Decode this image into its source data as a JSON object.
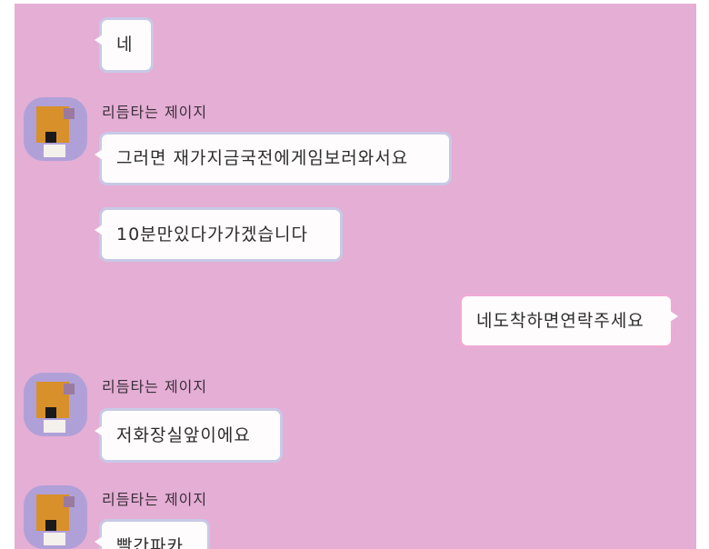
{
  "colors": {
    "chat_background": "#e4aed5",
    "bubble_background": "#fefcfd",
    "avatar_background": "#b0a0d8"
  },
  "messages": [
    {
      "type": "incoming",
      "text": "네"
    },
    {
      "type": "incoming",
      "sender": "리듬타는 제이지",
      "text": "그러면 재가지금국전에게임보러와서요"
    },
    {
      "type": "incoming",
      "text": "10분만있다가가겠습니다"
    },
    {
      "type": "outgoing",
      "text": "네도착하면연락주세요"
    },
    {
      "type": "incoming",
      "sender": "리듬타는 제이지",
      "text": "저화장실앞이에요"
    },
    {
      "type": "incoming",
      "sender": "리듬타는 제이지",
      "text": "빨간파카"
    }
  ]
}
